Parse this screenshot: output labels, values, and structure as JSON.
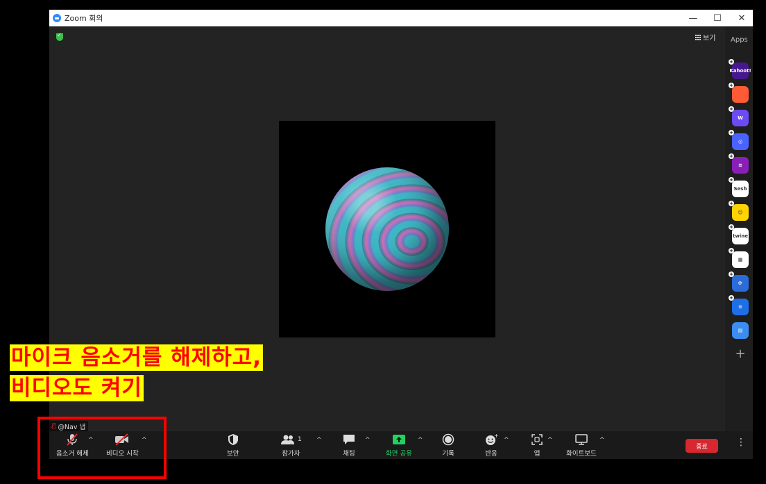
{
  "window": {
    "title": "Zoom 회의",
    "controls": {
      "minimize": "—",
      "maximize": "☐",
      "close": "✕"
    }
  },
  "stage": {
    "view_label": "보기",
    "security_badge": "shield-check-icon"
  },
  "sidebar": {
    "title": "Apps",
    "apps": [
      {
        "name": "Kahoot!",
        "color": "#46178f",
        "text": "Kahoot!"
      },
      {
        "name": "app-2",
        "color": "#ff5a36",
        "text": ""
      },
      {
        "name": "Wooclap",
        "color": "#6c4bf4",
        "text": "W"
      },
      {
        "name": "app-4",
        "color": "#4a63ff",
        "text": "◎"
      },
      {
        "name": "app-5",
        "color": "#8a1fb8",
        "text": "≋"
      },
      {
        "name": "Sesh",
        "color": "#ffffff",
        "text": "Sesh"
      },
      {
        "name": "app-7",
        "color": "#ffd400",
        "text": "☺"
      },
      {
        "name": "twine",
        "color": "#ffffff",
        "text": "twine"
      },
      {
        "name": "app-9",
        "color": "#ffffff",
        "text": "▦"
      },
      {
        "name": "app-10",
        "color": "#2b6cd9",
        "text": "⟳"
      },
      {
        "name": "app-11",
        "color": "#1e6fe6",
        "text": "≡"
      },
      {
        "name": "app-12",
        "color": "#3b8df0",
        "text": "▤"
      }
    ],
    "add": "+"
  },
  "participant": {
    "name": "@Nav 냅"
  },
  "toolbar": {
    "unmute": "음소거 해제",
    "start_video": "비디오 시작",
    "security": "보안",
    "participants": "참가자",
    "participants_count": "1",
    "chat": "채팅",
    "share_screen": "화면 공유",
    "record": "기록",
    "reactions": "반응",
    "apps": "앱",
    "whiteboard": "화이트보드",
    "end": "종료",
    "more": "⋮",
    "caret": "^"
  },
  "annotation": {
    "line1": "마이크 음소거를 해제하고,",
    "line2": "비디오도 켜기",
    "highlight_color": "#ffff00",
    "text_color": "#ff0000"
  }
}
